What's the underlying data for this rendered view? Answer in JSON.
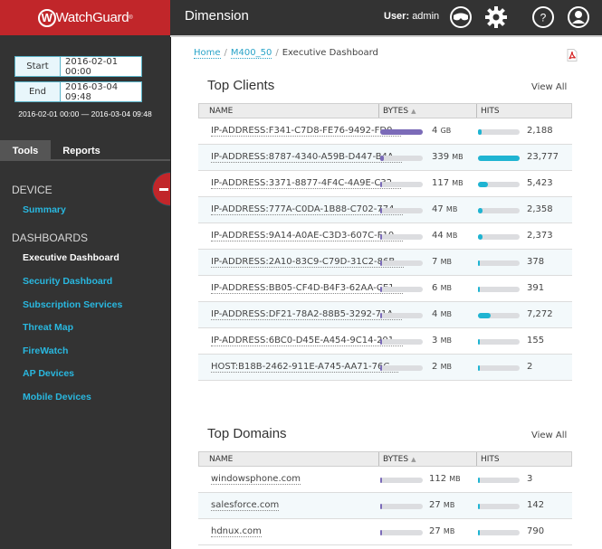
{
  "header": {
    "brand": "WatchGuard",
    "app_title": "Dimension",
    "user_label": "User:",
    "user_name": "admin",
    "icons": [
      "glasses-icon",
      "gear-icon",
      "help-icon",
      "user-icon"
    ]
  },
  "sidebar": {
    "date_range": {
      "start_label": "Start",
      "start_value": "2016-02-01 00:00",
      "end_label": "End",
      "end_value": "2016-03-04 09:48",
      "summary": "2016-02-01 00:00 — 2016-03-04 09:48"
    },
    "tabs": [
      {
        "label": "Tools",
        "active": true
      },
      {
        "label": "Reports",
        "active": false
      }
    ],
    "sections": [
      {
        "heading": "DEVICE",
        "items": [
          {
            "label": "Summary",
            "current": false
          }
        ]
      },
      {
        "heading": "DASHBOARDS",
        "items": [
          {
            "label": "Executive Dashboard",
            "current": true
          },
          {
            "label": "Security Dashboard",
            "current": false
          },
          {
            "label": "Subscription Services",
            "current": false
          },
          {
            "label": "Threat Map",
            "current": false
          },
          {
            "label": "FireWatch",
            "current": false
          },
          {
            "label": "AP Devices",
            "current": false
          },
          {
            "label": "Mobile Devices",
            "current": false
          }
        ]
      }
    ],
    "collapse_icon": "minus-icon"
  },
  "breadcrumb": {
    "items": [
      "Home",
      "M400_50"
    ],
    "current": "Executive Dashboard",
    "separator": "/"
  },
  "export_icon": "pdf-icon",
  "colors": {
    "brand_red": "#c1262a",
    "bytes_bar": "#7b6bb8",
    "hits_bar": "#1fb4d2",
    "link": "#29b8e0"
  },
  "top_clients": {
    "title": "Top Clients",
    "view_all": "View All",
    "columns": [
      "NAME",
      "BYTES",
      "HITS"
    ],
    "rows": [
      {
        "name": "IP-ADDRESS:F341-C7D8-FE76-9492-FD9...",
        "bytes": "4",
        "unit": "GB",
        "bytes_pct": 100,
        "hits": "2,188",
        "hits_pct": 9
      },
      {
        "name": "IP-ADDRESS:8787-4340-A59B-D447-B4A...",
        "bytes": "339",
        "unit": "MB",
        "bytes_pct": 8,
        "hits": "23,777",
        "hits_pct": 100
      },
      {
        "name": "IP-ADDRESS:3371-8877-4F4C-4A9E-C32...",
        "bytes": "117",
        "unit": "MB",
        "bytes_pct": 3,
        "hits": "5,423",
        "hits_pct": 23
      },
      {
        "name": "IP-ADDRESS:777A-C0DA-1B88-C702-774...",
        "bytes": "47",
        "unit": "MB",
        "bytes_pct": 1,
        "hits": "2,358",
        "hits_pct": 10
      },
      {
        "name": "IP-ADDRESS:9A14-A0AE-C3D3-607C-F10...",
        "bytes": "44",
        "unit": "MB",
        "bytes_pct": 1,
        "hits": "2,373",
        "hits_pct": 10
      },
      {
        "name": "IP-ADDRESS:2A10-83C9-C79D-31C2-86B...",
        "bytes": "7",
        "unit": "MB",
        "bytes_pct": 0.5,
        "hits": "378",
        "hits_pct": 2
      },
      {
        "name": "IP-ADDRESS:BB05-CF4D-B4F3-62AA-CE1...",
        "bytes": "6",
        "unit": "MB",
        "bytes_pct": 0.5,
        "hits": "391",
        "hits_pct": 2
      },
      {
        "name": "IP-ADDRESS:DF21-78A2-88B5-3292-71A...",
        "bytes": "4",
        "unit": "MB",
        "bytes_pct": 0.5,
        "hits": "7,272",
        "hits_pct": 31
      },
      {
        "name": "IP-ADDRESS:6BC0-D45E-A454-9C14-201...",
        "bytes": "3",
        "unit": "MB",
        "bytes_pct": 0.5,
        "hits": "155",
        "hits_pct": 1
      },
      {
        "name": "HOST:B18B-2462-911E-A745-AA71-76C...",
        "bytes": "2",
        "unit": "MB",
        "bytes_pct": 0.5,
        "hits": "2",
        "hits_pct": 1
      }
    ]
  },
  "top_domains": {
    "title": "Top Domains",
    "view_all": "View All",
    "columns": [
      "NAME",
      "BYTES",
      "HITS"
    ],
    "rows": [
      {
        "name": "windowsphone.com",
        "bytes": "112",
        "unit": "MB",
        "bytes_pct": 1,
        "hits": "3",
        "hits_pct": 1
      },
      {
        "name": "salesforce.com",
        "bytes": "27",
        "unit": "MB",
        "bytes_pct": 1,
        "hits": "142",
        "hits_pct": 1
      },
      {
        "name": "hdnux.com",
        "bytes": "27",
        "unit": "MB",
        "bytes_pct": 1,
        "hits": "790",
        "hits_pct": 2
      }
    ]
  }
}
